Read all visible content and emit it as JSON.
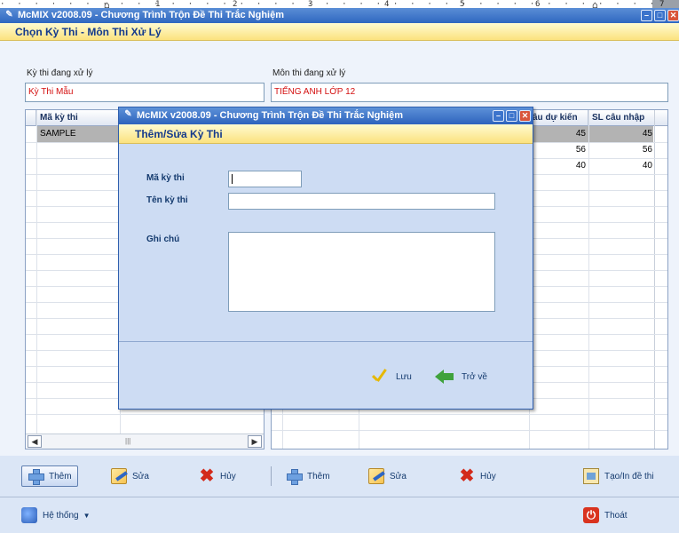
{
  "ruler": {
    "dots": "·  ·  ·  ·  ·  ·  ·  ·  ·  ·  ·  ·  ·  ·  ·  ·  ·  ·  ·  ·  ·  ·  ·  ·  ·  ·  ·  ·  ·  ·  ·  ·  ·  ·  ·  ·  ·  ·  ·  ·  ·  ·  ·  ·  ·  ·  ·  ·  ·  ·  ·  ·  ·  ·  ·  ·  ·  ·  ·  ·  ·  ·  ·  ·  ·  ·  ·  ·  ·  ·  ·  ·  ·  ·  ·  ·  ·  ·  ·  ·  ·  ·  ·  ·  ·  ·  ·  ·  ·  ·  ·  ·  ·  ·  ·  ·  ·  ·  ·  ·  ·  ·  ·  ·  ·  ·  ·  ·  ·  ·",
    "numbers": [
      "1",
      "2",
      "3",
      "4",
      "5",
      "6",
      "7"
    ]
  },
  "main": {
    "title": "McMIX v2008.09 - Chương Trình Trộn Đề Thi Trắc Nghiệm",
    "subtitle": "Chọn Kỳ Thi - Môn Thi Xử Lý",
    "exam_label": "Kỳ thi đang xử lý",
    "exam_value": "Kỳ Thi Mẫu",
    "subject_label": "Môn thi đang xử lý",
    "subject_value": "TIẾNG ANH LỚP 12"
  },
  "left_grid": {
    "header": "Mã kỳ thi",
    "rows": [
      "SAMPLE"
    ]
  },
  "right_grid": {
    "headers": [
      "âu dự kiến",
      "SL câu nhập"
    ],
    "rows": [
      [
        "45",
        "45"
      ],
      [
        "56",
        "56"
      ],
      [
        "40",
        "40"
      ]
    ]
  },
  "toolbar": {
    "add": "Thêm",
    "edit": "Sửa",
    "delete": "Hủy",
    "add2": "Thêm",
    "edit2": "Sửa",
    "delete2": "Hủy",
    "generate": "Tạo/In đề thi",
    "system": "Hệ thống",
    "exit": "Thoát"
  },
  "dialog": {
    "title": "McMIX v2008.09 - Chương Trình Trộn Đề Thi Trắc Nghiệm",
    "subtitle": "Thêm/Sửa Kỳ Thi",
    "code_label": "Mã kỳ thi",
    "code_value": "",
    "name_label": "Tên kỳ thi",
    "name_value": "",
    "note_label": "Ghi chú",
    "note_value": "",
    "save": "Lưu",
    "back": "Trở về"
  },
  "colors": {
    "title_bar": "#2f67c0",
    "header_band": "#fbe27e",
    "field_text": "#d41010",
    "selected_row": "#b3b3b3"
  }
}
